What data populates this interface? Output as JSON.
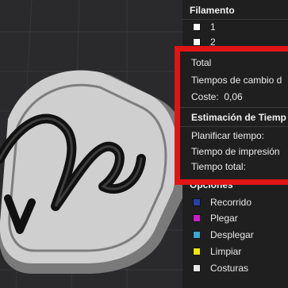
{
  "filament": {
    "title": "Filamento",
    "items": [
      {
        "label": "1",
        "color": "#ffffff"
      },
      {
        "label": "2",
        "color": "#ffffff"
      }
    ]
  },
  "summary": {
    "total_label": "Total",
    "change_time_label": "Tiempos de cambio d",
    "cost_label": "Coste:",
    "cost_value": "0,06"
  },
  "estimation": {
    "title": "Estimación de Tiemp",
    "plan_label": "Planificar tiempo:",
    "print_label": "Tiempo de impresión",
    "total_label": "Tiempo total:"
  },
  "options": {
    "title": "Opciones",
    "items": [
      {
        "label": "Recorrido",
        "color": "#2a3fa8"
      },
      {
        "label": "Plegar",
        "color": "#c81fc8"
      },
      {
        "label": "Desplegar",
        "color": "#3aa7d0"
      },
      {
        "label": "Limpiar",
        "color": "#f2e600"
      },
      {
        "label": "Costuras",
        "color": "#e8e8e8"
      }
    ]
  },
  "colors": {
    "highlight": "#e01515",
    "panel": "#1f1f1f"
  }
}
